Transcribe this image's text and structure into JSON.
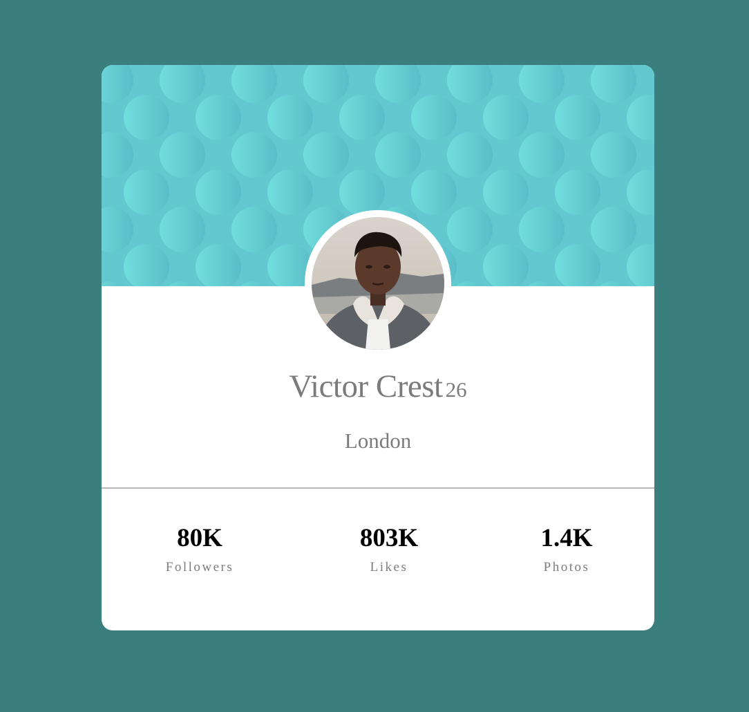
{
  "profile": {
    "name": "Victor Crest",
    "age": "26",
    "city": "London"
  },
  "stats": [
    {
      "value": "80K",
      "label": "Followers"
    },
    {
      "value": "803K",
      "label": "Likes"
    },
    {
      "value": "1.4K",
      "label": "Photos"
    }
  ],
  "colors": {
    "page_background": "#3a7f7e",
    "card_background": "#ffffff",
    "banner_base": "#63c8cf",
    "banner_circle_light": "#72e1df",
    "banner_circle_dark": "#5bbcc9",
    "muted_text": "#7b7b7b",
    "stat_value_text": "#000000",
    "divider": "#b8b8b8"
  },
  "icons": {
    "banner_pattern": "circles-pattern",
    "avatar": "profile-photo"
  }
}
